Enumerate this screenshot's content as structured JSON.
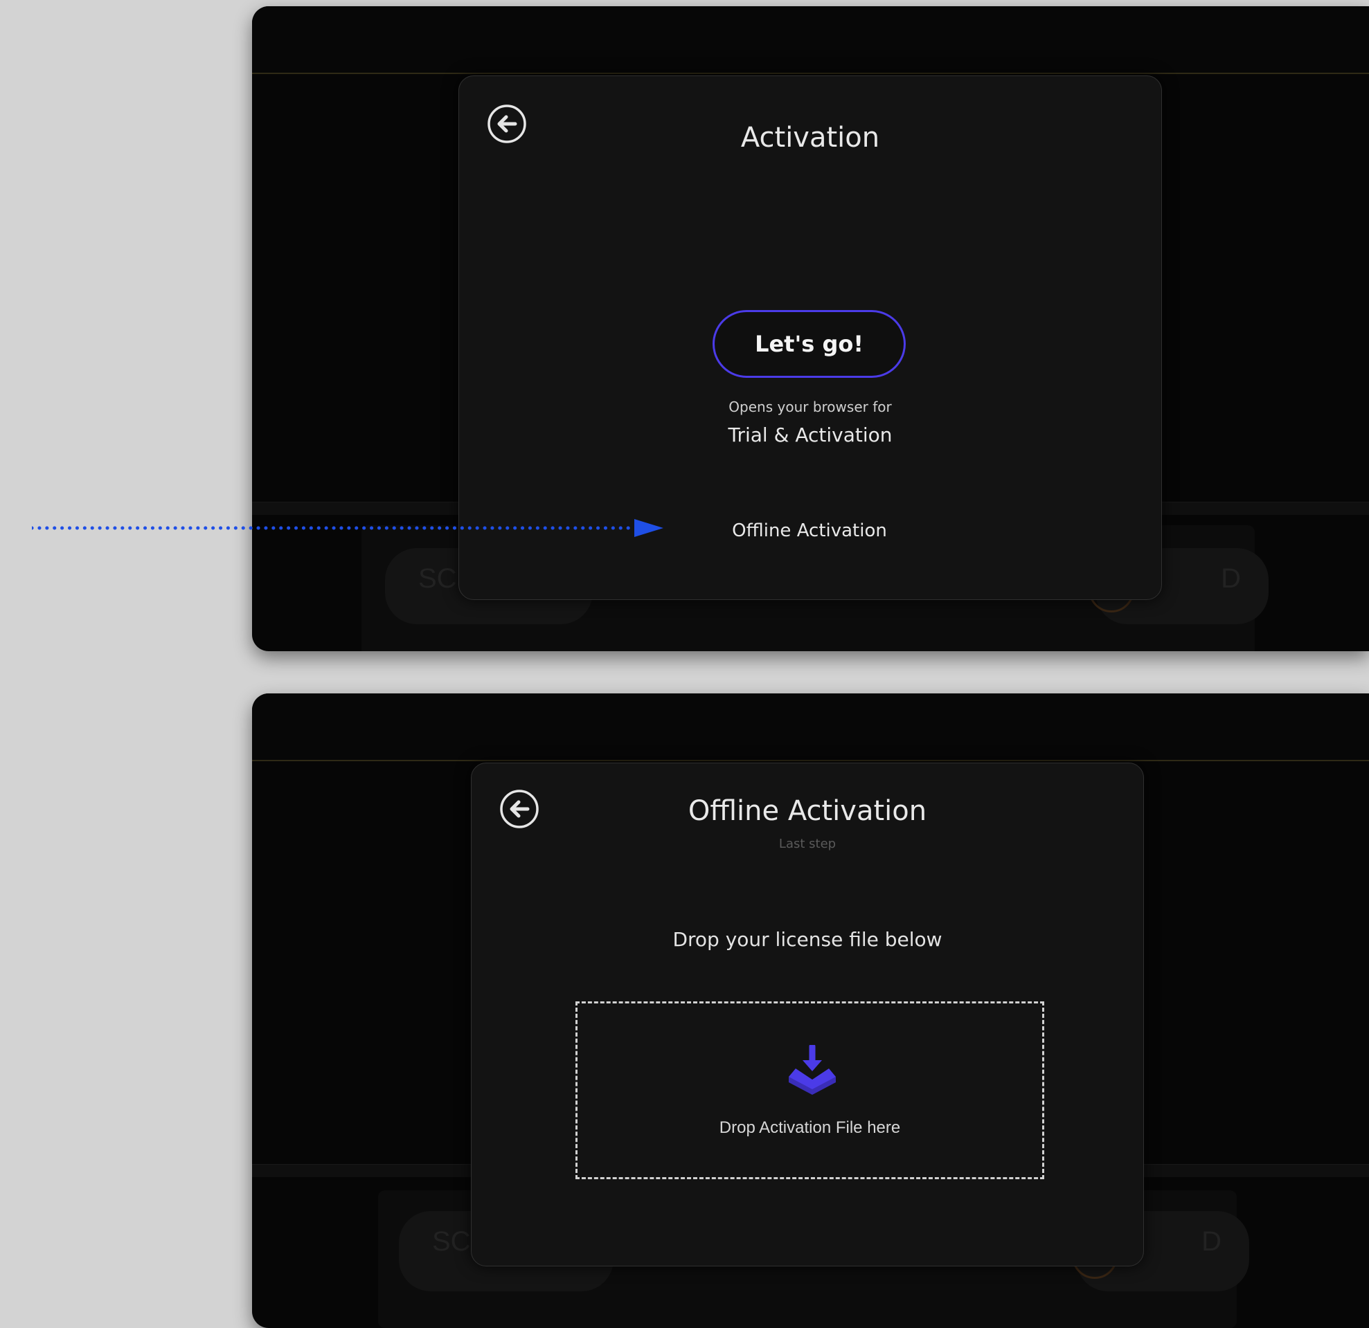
{
  "activation_screen": {
    "title": "Activation",
    "lets_go_label": "Let's go!",
    "browser_hint_small": "Opens your browser for",
    "browser_hint_large": "Trial & Activation",
    "offline_link_label": "Offline Activation",
    "background": {
      "left_pill_text": "SC",
      "right_pill_text": "D"
    }
  },
  "offline_screen": {
    "title": "Offline Activation",
    "subtitle": "Last step",
    "instruction": "Drop your license file below",
    "dropzone_label": "Drop Activation File here",
    "background": {
      "left_pill_text": "SC",
      "right_pill_text": "D"
    }
  },
  "icons": {
    "back": "arrow-left-circle-icon",
    "drop": "download-tray-icon",
    "annotation": "dotted-arrow"
  },
  "colors": {
    "accent": "#4b3be8",
    "annotation_arrow": "#1f4fe6",
    "dialog_bg": "#131313",
    "outer_bg": "#d3d3d3"
  }
}
